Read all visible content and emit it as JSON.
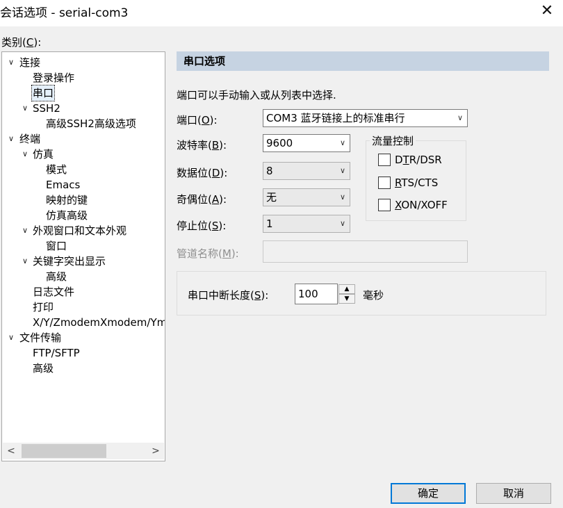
{
  "window": {
    "title": "会话选项 - serial-com3",
    "close_glyph": "✕"
  },
  "category": {
    "label": "类别(C):",
    "label_pre": "类别(",
    "label_key": "C",
    "label_post": "):"
  },
  "tree": {
    "items": [
      {
        "label": "连接",
        "expand": "∨"
      },
      {
        "label": "登录操作"
      },
      {
        "label": "串口"
      },
      {
        "label": "SSH2",
        "expand": "∨"
      },
      {
        "label": "高级SSH2高级选项"
      },
      {
        "label": "终端",
        "expand": "∨"
      },
      {
        "label": "仿真",
        "expand": "∨"
      },
      {
        "label": "模式"
      },
      {
        "label": "Emacs"
      },
      {
        "label": "映射的键"
      },
      {
        "label": "仿真高级"
      },
      {
        "label": "外观窗口和文本外观",
        "expand": "∨"
      },
      {
        "label": "窗口"
      },
      {
        "label": "关键字突出显示",
        "expand": "∨"
      },
      {
        "label": "高级"
      },
      {
        "label": "日志文件"
      },
      {
        "label": "打印"
      },
      {
        "label": "X/Y/ZmodemXmodem/Ymodem"
      },
      {
        "label": "文件传输",
        "expand": "∨"
      },
      {
        "label": "FTP/SFTP"
      },
      {
        "label": "高级"
      }
    ],
    "selected": "串口",
    "scroll_left": "<",
    "scroll_right": ">"
  },
  "serial": {
    "header": "串口选项",
    "description": "端口可以手动输入或从列表中选择.",
    "port": {
      "label_pre": "端口(",
      "key": "O",
      "label_post": "):",
      "value": "COM3 蓝牙链接上的标准串行"
    },
    "baud": {
      "label_pre": "波特率(",
      "key": "B",
      "label_post": "):",
      "value": "9600"
    },
    "data_bits": {
      "label_pre": "数据位(",
      "key": "D",
      "label_post": "):",
      "value": "8"
    },
    "parity": {
      "label_pre": "奇偶位(",
      "key": "A",
      "label_post": "):",
      "value": "无"
    },
    "stop_bits": {
      "label_pre": "停止位(",
      "key": "S",
      "label_post": "):",
      "value": "1"
    },
    "pipe": {
      "label_pre": "管道名称(",
      "key": "M",
      "label_post": "):",
      "value": ""
    },
    "dropdown_glyph": "∨"
  },
  "flow_control": {
    "title": "流量控制",
    "options": [
      {
        "pre": "D",
        "key": "T",
        "post": "R/DSR",
        "checked": false
      },
      {
        "pre": "",
        "key": "R",
        "post": "TS/CTS",
        "checked": false
      },
      {
        "pre": "",
        "key": "X",
        "post": "ON/XOFF",
        "checked": false
      }
    ]
  },
  "break_length": {
    "label_pre": "串口中断长度(",
    "key": "S",
    "label_post": "):",
    "value": "100",
    "unit": "毫秒",
    "up": "▲",
    "down": "▼"
  },
  "buttons": {
    "ok": "确定",
    "cancel": "取消"
  }
}
